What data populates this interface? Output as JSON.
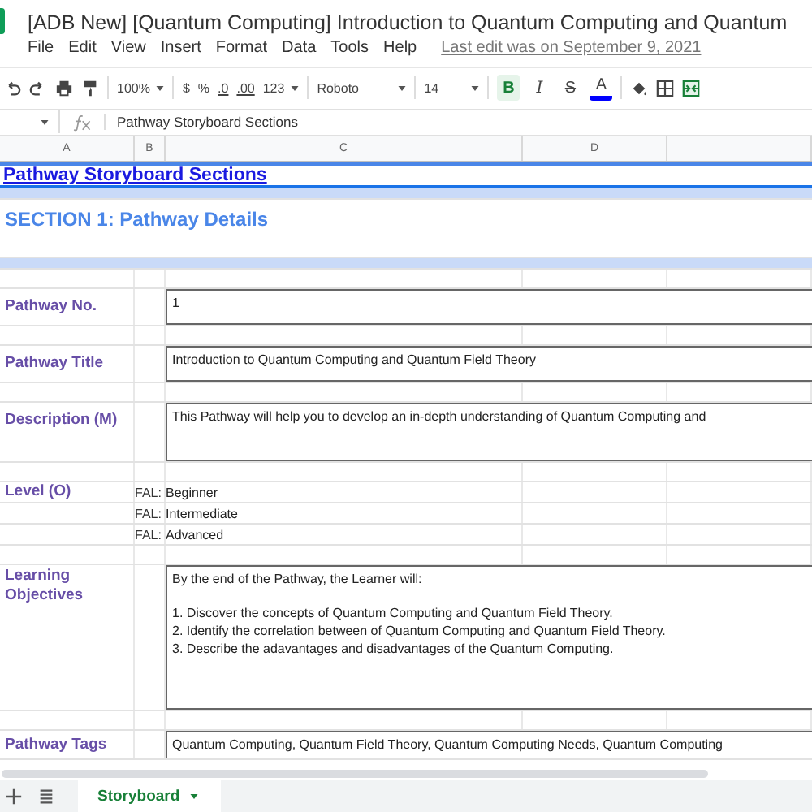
{
  "document": {
    "title": "[ADB New] [Quantum Computing] Introduction to Quantum Computing and Quantum",
    "last_edit": "Last edit was on September 9, 2021"
  },
  "menu": [
    "File",
    "Edit",
    "View",
    "Insert",
    "Format",
    "Data",
    "Tools",
    "Help"
  ],
  "toolbar": {
    "zoom": "100%",
    "currency": "$",
    "percent": "%",
    "decimals": [
      ".0",
      ".00"
    ],
    "number_format": "123",
    "font": "Roboto",
    "font_size": "14",
    "format_buttons": [
      {
        "kind": "bold",
        "label": "B",
        "selected": true
      },
      {
        "kind": "italic",
        "label": "I",
        "selected": false
      },
      {
        "kind": "strike",
        "label": "S",
        "selected": false
      },
      {
        "kind": "color",
        "label": "A",
        "selected": false
      }
    ]
  },
  "formula_bar": {
    "value": "Pathway Storyboard Sections"
  },
  "columns": [
    "A",
    "B",
    "C",
    "D",
    ""
  ],
  "rows": [
    {
      "kind": "title",
      "text": "Pathway Storyboard Sections"
    },
    {
      "kind": "band"
    },
    {
      "kind": "section",
      "text": "SECTION 1: Pathway Details"
    },
    {
      "kind": "band"
    },
    {
      "kind": "spacer"
    },
    {
      "kind": "short_field",
      "label": "Pathway No.",
      "value": "1"
    },
    {
      "kind": "spacer"
    },
    {
      "kind": "short_field",
      "label": "Pathway Title",
      "value": "Introduction to Quantum Computing and Quantum Field Theory"
    },
    {
      "kind": "spacer"
    },
    {
      "kind": "long_field",
      "label": "Description (M)",
      "value": "This Pathway will help you to develop an in-depth understanding of Quantum Computing and"
    },
    {
      "kind": "spacer"
    },
    {
      "kind": "options",
      "label": "Level (O)",
      "options": [
        {
          "prefix": "FAL:",
          "value": "Beginner"
        },
        {
          "prefix": "FAL:",
          "value": "Intermediate"
        },
        {
          "prefix": "FAL:",
          "value": "Advanced"
        }
      ]
    },
    {
      "kind": "spacer"
    },
    {
      "kind": "list_field",
      "label": "Learning Objectives",
      "intro": "By the end of the Pathway, the Learner will:",
      "items": [
        "1. Discover the concepts of Quantum Computing and Quantum Field Theory.",
        "2. Identify the correlation between of Quantum Computing and Quantum Field Theory.",
        "3. Describe the adavantages and disadvantages of the Quantum Computing."
      ]
    },
    {
      "kind": "spacer"
    },
    {
      "kind": "tags_field",
      "label": "Pathway Tags",
      "value": "Quantum Computing, Quantum Field Theory, Quantum Computing Needs, Quantum Computing"
    }
  ],
  "sheet_tabs": [
    {
      "label": "Storyboard",
      "selected": true
    }
  ]
}
